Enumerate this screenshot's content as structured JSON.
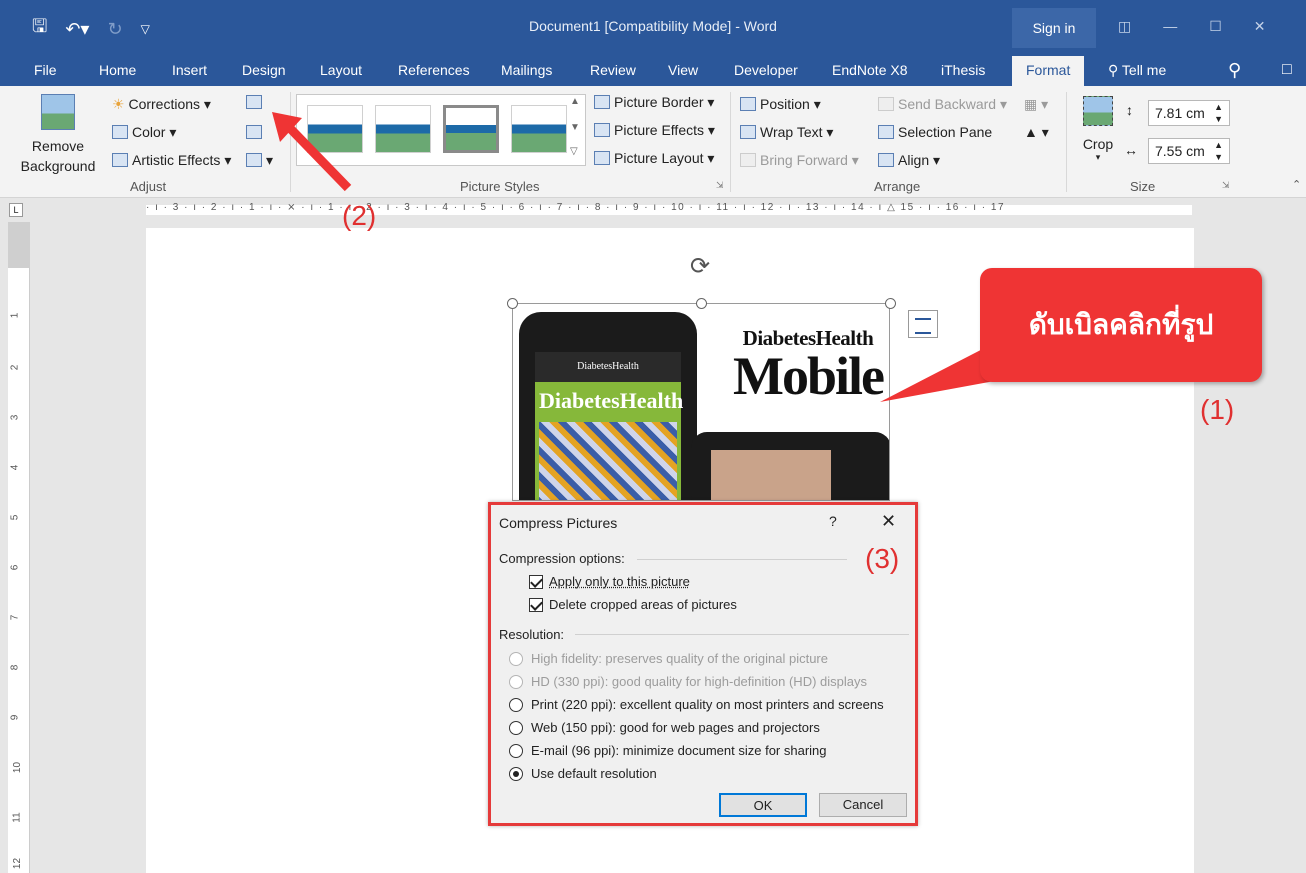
{
  "titlebar": {
    "doc_title": "Document1 [Compatibility Mode]  -  Word",
    "sign_in": "Sign in",
    "qat_icons": [
      "save-icon",
      "undo-icon",
      "redo-icon",
      "customize-icon"
    ]
  },
  "tabs": [
    "File",
    "Home",
    "Insert",
    "Design",
    "Layout",
    "References",
    "Mailings",
    "Review",
    "View",
    "Developer",
    "EndNote X8",
    "iThesis",
    "Format",
    "Tell me"
  ],
  "active_tab": "Format",
  "ribbon": {
    "remove_background": "Remove Background",
    "adjust": {
      "corrections": "Corrections",
      "color": "Color",
      "artistic_effects": "Artistic Effects",
      "label": "Adjust"
    },
    "picture_styles": {
      "border": "Picture Border",
      "effects": "Picture Effects",
      "layout": "Picture Layout",
      "label": "Picture Styles"
    },
    "arrange": {
      "position": "Position",
      "wrap_text": "Wrap Text",
      "bring_forward": "Bring Forward",
      "send_backward": "Send Backward",
      "selection_pane": "Selection Pane",
      "align": "Align",
      "label": "Arrange"
    },
    "size": {
      "crop": "Crop",
      "height": "7.81 cm",
      "width": "7.55 cm",
      "label": "Size"
    }
  },
  "ruler": {
    "top_numbers": "· ı · 3 · ı · 2 · ı · 1 · ı · ⨯ · ı · 1 · ı · 2 · ı · 3 · ı · 4 · ı · 5 · ı · 6 · ı · 7 · ı · 8 · ı · 9 · ı · 10 · ı · 11 · ı · 12 · ı · 13 · ı · 14 · ı △ 15 · ı · 16 · ı · 17",
    "left_numbers": [
      "1",
      "2",
      "3",
      "4",
      "5",
      "6",
      "7",
      "8",
      "9",
      "10",
      "11",
      "12"
    ]
  },
  "picture": {
    "brand_sub": "DiabetesHealth",
    "brand_main": "Mobile",
    "phone_header": "DiabetesHealth",
    "phone_mag": "DiabetesHealth"
  },
  "callout": {
    "text": "ดับเบิลคลิกที่รูป"
  },
  "markers": {
    "m1": "(1)",
    "m2": "(2)",
    "m3": "(3)"
  },
  "dialog": {
    "title": "Compress Pictures",
    "help": "?",
    "close": "✕",
    "compression_label": "Compression options:",
    "apply_only": "Apply only to this picture",
    "delete_cropped": "Delete cropped areas of pictures",
    "resolution_label": "Resolution:",
    "options": [
      "High fidelity: preserves quality of the original picture",
      "HD (330 ppi): good quality for high-definition (HD) displays",
      "Print (220 ppi): excellent quality on most printers and screens",
      "Web (150 ppi): good for web pages and projectors",
      "E-mail (96 ppi): minimize document size for sharing",
      "Use default resolution"
    ],
    "selected_option": 5,
    "ok": "OK",
    "cancel": "Cancel"
  }
}
